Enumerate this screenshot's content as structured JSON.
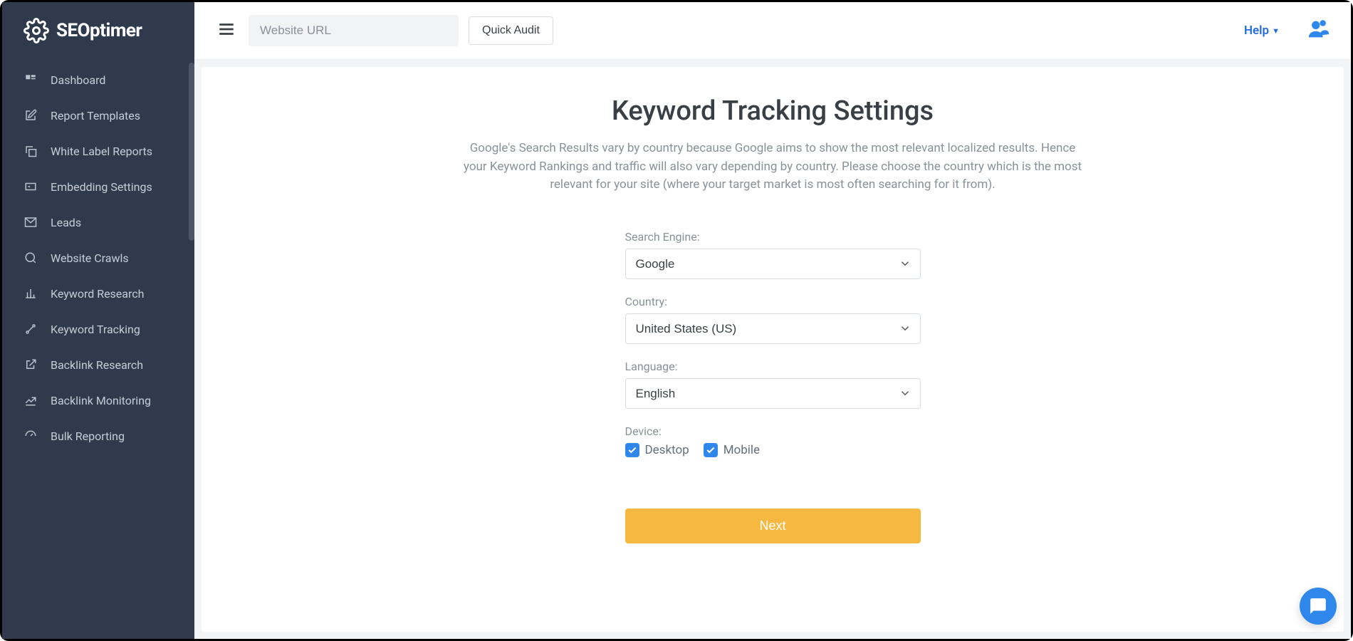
{
  "brand": {
    "name": "SEOptimer"
  },
  "sidebar": {
    "items": [
      {
        "label": "Dashboard"
      },
      {
        "label": "Report Templates"
      },
      {
        "label": "White Label Reports"
      },
      {
        "label": "Embedding Settings"
      },
      {
        "label": "Leads"
      },
      {
        "label": "Website Crawls"
      },
      {
        "label": "Keyword Research"
      },
      {
        "label": "Keyword Tracking"
      },
      {
        "label": "Backlink Research"
      },
      {
        "label": "Backlink Monitoring"
      },
      {
        "label": "Bulk Reporting"
      }
    ]
  },
  "topbar": {
    "url_placeholder": "Website URL",
    "quick_audit_label": "Quick Audit",
    "help_label": "Help"
  },
  "page": {
    "title": "Keyword Tracking Settings",
    "description": "Google's Search Results vary by country because Google aims to show the most relevant localized results. Hence your Keyword Rankings and traffic will also vary depending by country. Please choose the country which is the most relevant for your site (where your target market is most often searching for it from)."
  },
  "form": {
    "search_engine": {
      "label": "Search Engine:",
      "value": "Google"
    },
    "country": {
      "label": "Country:",
      "value": "United States (US)"
    },
    "language": {
      "label": "Language:",
      "value": "English"
    },
    "device": {
      "label": "Device:",
      "desktop_label": "Desktop",
      "mobile_label": "Mobile"
    },
    "next_label": "Next"
  },
  "colors": {
    "sidebar_bg": "#2f3b4c",
    "primary": "#2f86eb",
    "accent": "#f5b942"
  }
}
